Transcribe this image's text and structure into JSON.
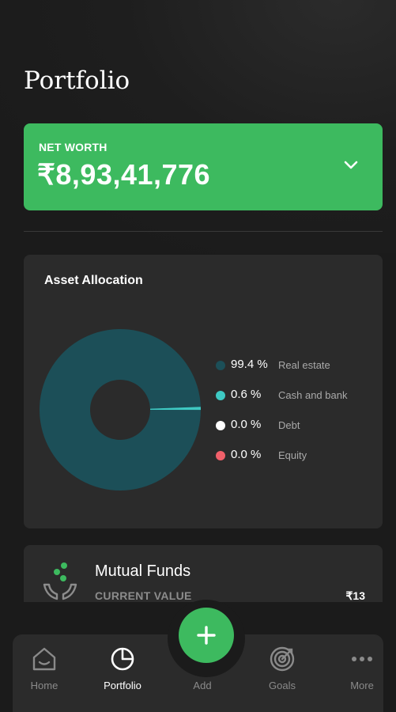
{
  "page": {
    "title": "Portfolio"
  },
  "net_worth": {
    "label": "NET WORTH",
    "value": "₹8,93,41,776"
  },
  "asset_allocation": {
    "title": "Asset Allocation",
    "items": [
      {
        "percent": "99.4 %",
        "name": "Real estate",
        "color": "#1c4f58",
        "share": 99.4
      },
      {
        "percent": "0.6 %",
        "name": "Cash and bank",
        "color": "#3ec9c3",
        "share": 0.6
      },
      {
        "percent": "0.0 %",
        "name": "Debt",
        "color": "#ffffff",
        "share": 0.0
      },
      {
        "percent": "0.0 %",
        "name": "Equity",
        "color": "#f0606a",
        "share": 0.0
      }
    ]
  },
  "mutual_funds": {
    "title": "Mutual Funds",
    "subtitle": "CURRENT VALUE",
    "value": "₹13"
  },
  "nav": {
    "items": [
      {
        "label": "Home",
        "icon": "home-icon"
      },
      {
        "label": "Portfolio",
        "icon": "pie-chart-icon",
        "active": true
      },
      {
        "label": "Add",
        "icon": "plus-icon"
      },
      {
        "label": "Goals",
        "icon": "target-icon"
      },
      {
        "label": "More",
        "icon": "more-dots-icon"
      }
    ]
  },
  "colors": {
    "accent": "#3dba5f",
    "card": "#2b2b2b",
    "background": "#1b1b1b"
  }
}
